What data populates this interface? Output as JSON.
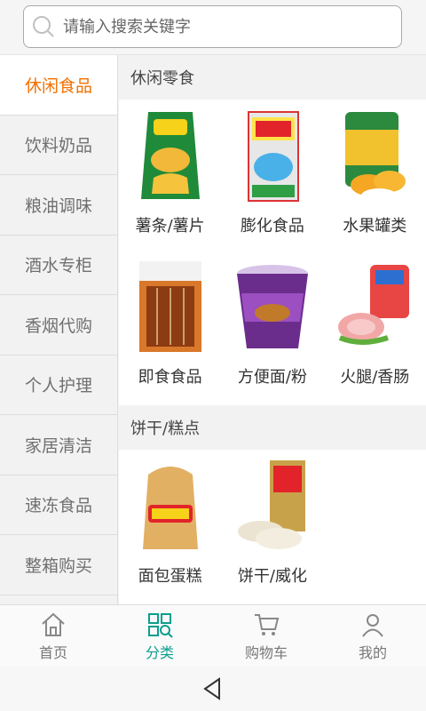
{
  "search": {
    "placeholder": "请输入搜索关键字"
  },
  "sidebar": {
    "items": [
      {
        "label": "休闲食品",
        "active": true
      },
      {
        "label": "饮料奶品"
      },
      {
        "label": "粮油调味"
      },
      {
        "label": "酒水专柜"
      },
      {
        "label": "香烟代购"
      },
      {
        "label": "个人护理"
      },
      {
        "label": "家居清洁"
      },
      {
        "label": "速冻食品"
      },
      {
        "label": "整箱购买"
      }
    ]
  },
  "sections": [
    {
      "title": "休闲零食",
      "items": [
        {
          "label": "薯条/薯片",
          "icon": "chips-bag-icon"
        },
        {
          "label": "膨化食品",
          "icon": "puffed-snack-box-icon"
        },
        {
          "label": "水果罐类",
          "icon": "canned-fruit-icon"
        },
        {
          "label": "即食食品",
          "icon": "ready-food-pack-icon"
        },
        {
          "label": "方便面/粉",
          "icon": "instant-noodle-cup-icon"
        },
        {
          "label": "火腿/香肠",
          "icon": "ham-sausage-icon"
        }
      ]
    },
    {
      "title": "饼干/糕点",
      "items": [
        {
          "label": "面包蛋糕",
          "icon": "bread-pack-icon"
        },
        {
          "label": "饼干/威化",
          "icon": "rice-cracker-icon"
        }
      ]
    }
  ],
  "tabbar": {
    "tabs": [
      {
        "label": "首页",
        "icon": "home-icon"
      },
      {
        "label": "分类",
        "icon": "category-icon",
        "active": true
      },
      {
        "label": "购物车",
        "icon": "cart-icon"
      },
      {
        "label": "我的",
        "icon": "user-icon"
      }
    ]
  },
  "colors": {
    "accent": "#f07000",
    "tab_active": "#0b9e8e"
  }
}
